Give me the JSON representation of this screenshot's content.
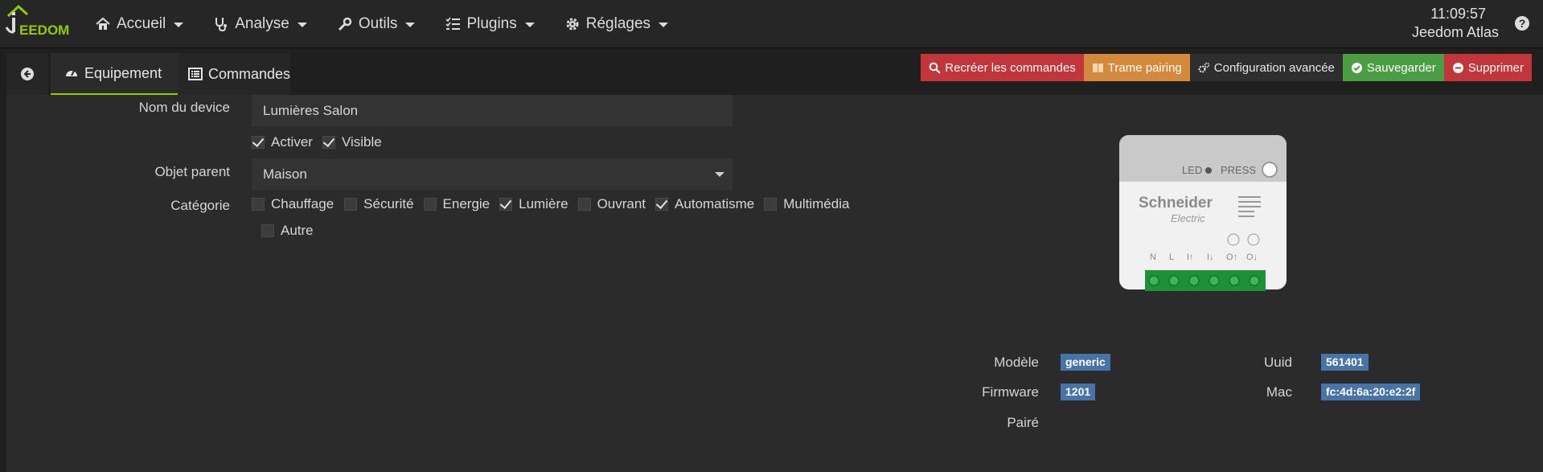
{
  "nav": {
    "logo_text": "EEDOM",
    "items": [
      {
        "label": "Accueil",
        "icon": "home-icon"
      },
      {
        "label": "Analyse",
        "icon": "stethoscope-icon"
      },
      {
        "label": "Outils",
        "icon": "wrench-icon"
      },
      {
        "label": "Plugins",
        "icon": "tasks-icon"
      },
      {
        "label": "Réglages",
        "icon": "cog-icon"
      }
    ],
    "clock": "11:09:57",
    "hostname": "Jeedom Atlas"
  },
  "tabs": {
    "equipement": "Equipement",
    "commandes": "Commandes"
  },
  "actions": {
    "recreate": "Recréer les commandes",
    "trame": "Trame pairing",
    "config": "Configuration avancée",
    "save": "Sauvegarder",
    "delete": "Supprimer"
  },
  "form": {
    "name_label": "Nom du device",
    "name_value": "Lumières Salon",
    "activate": "Activer",
    "visible": "Visible",
    "parent_label": "Objet parent",
    "parent_value": "Maison",
    "category_label": "Catégorie",
    "categories": [
      {
        "label": "Chauffage",
        "checked": false
      },
      {
        "label": "Sécurité",
        "checked": false
      },
      {
        "label": "Energie",
        "checked": false
      },
      {
        "label": "Lumière",
        "checked": true
      },
      {
        "label": "Ouvrant",
        "checked": false
      },
      {
        "label": "Automatisme",
        "checked": true
      },
      {
        "label": "Multimédia",
        "checked": false
      },
      {
        "label": "Autre",
        "checked": false
      }
    ]
  },
  "device_image": {
    "brand": "Schneider",
    "brand_sub": "Electric",
    "led": "LED",
    "press": "PRESS",
    "terminals": [
      "N",
      "L",
      "I↑",
      "I↓",
      "O↑",
      "O↓"
    ]
  },
  "info": {
    "model_label": "Modèle",
    "model_value": "generic",
    "firmware_label": "Firmware",
    "firmware_value": "1201",
    "paired_label": "Pairé",
    "uuid_label": "Uuid",
    "uuid_value": "561401",
    "mac_label": "Mac",
    "mac_value": "fc:4d:6a:20:e2:2f"
  },
  "colors": {
    "accent": "#94ca02",
    "danger": "#c2363a",
    "warning": "#d5893a",
    "success": "#4a9d43",
    "badge": "#4673a8"
  }
}
